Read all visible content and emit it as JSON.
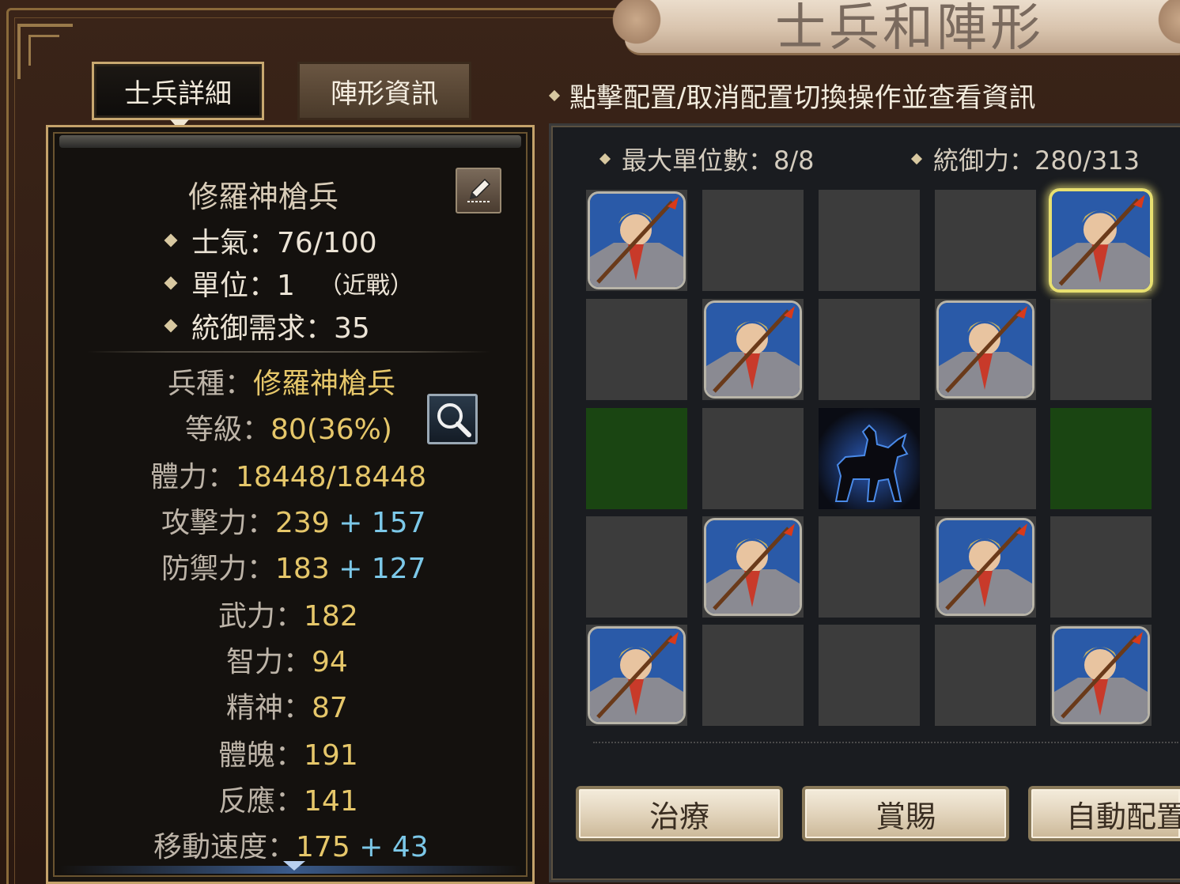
{
  "title": "士兵和陣形",
  "tabs": {
    "soldier_detail": "士兵詳細",
    "formation_info": "陣形資訊"
  },
  "instruction": "點擊配置/取消配置切換操作並查看資訊",
  "unit": {
    "name": "修羅神槍兵",
    "morale": "士氣：76/100",
    "units": "單位：1",
    "unit_type": "（近戰）",
    "command_req": "統御需求：35"
  },
  "stats": {
    "troop_type_label": "兵種：",
    "troop_type_value": "修羅神槍兵",
    "level_label": "等級：",
    "level_value": "80(36%)",
    "hp_label": "體力：",
    "hp_value": "18448/18448",
    "atk_label": "攻擊力：",
    "atk_base": "239",
    "atk_bonus": "+ 157",
    "def_label": "防禦力：",
    "def_base": "183",
    "def_bonus": "+ 127",
    "str_label": "武力：",
    "str_value": "182",
    "int_label": "智力：",
    "int_value": "94",
    "spi_label": "精神：",
    "spi_value": "87",
    "con_label": "體魄：",
    "con_value": "191",
    "ref_label": "反應：",
    "ref_value": "141",
    "spd_label": "移動速度：",
    "spd_base": "175",
    "spd_bonus": "+ 43"
  },
  "formation": {
    "max_units": "最大單位數：8/8",
    "command": "統御力：280/313"
  },
  "buttons": {
    "heal": "治療",
    "reward": "賞賜",
    "auto": "自動配置"
  },
  "colors": {
    "stat_value": "#e6c76a",
    "stat_bonus": "#7cc8e8",
    "deploy_zone": "#1a4512",
    "selected_glow": "#e8e070"
  }
}
